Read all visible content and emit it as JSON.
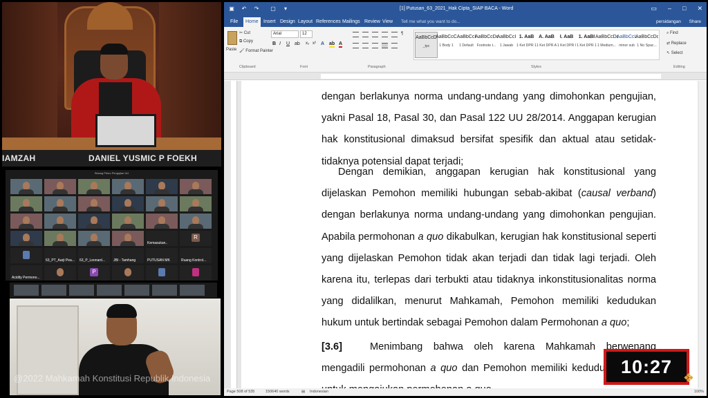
{
  "judge_panel": {
    "nameplate_left": "IAMZAH",
    "nameplate_main": "DANIEL YUSMIC P FOEKH"
  },
  "gallery": {
    "title": "Sidang Pleno Pengujian UU",
    "named_tiles": [
      {
        "label": "Kemasukan..",
        "initial": ""
      },
      {
        "label": "",
        "initial": "R"
      },
      {
        "label": "",
        "initial": ""
      },
      {
        "label": "63_PT_Aarji Pea...",
        "initial": ""
      },
      {
        "label": "63_P_Leonard...",
        "initial": ""
      },
      {
        "label": "JBI - Tamhang",
        "initial": ""
      },
      {
        "label": "PUTUSAN MK",
        "initial": ""
      },
      {
        "label": "Ruang Kontrol...",
        "initial": ""
      },
      {
        "label": "Acidity Permono...",
        "initial": ""
      },
      {
        "label": "",
        "initial": "P"
      }
    ]
  },
  "watermark": "@2022 Mahkamah Konstitusi Republik Indonesia",
  "word": {
    "title": "[1] Putusan_63_2021_Hak Cipta_SIAP BACA - Word",
    "tabs": [
      "File",
      "Home",
      "Insert",
      "Design",
      "Layout",
      "References",
      "Mailings",
      "Review",
      "View"
    ],
    "active_tab": "Home",
    "tell_me": "Tell me what you want to do...",
    "user": "persidangan",
    "share": "Share",
    "clipboard": {
      "paste": "Paste",
      "cut": "Cut",
      "copy": "Copy",
      "format_painter": "Format Painter",
      "label": "Clipboard"
    },
    "font": {
      "name": "Arial",
      "size": "12",
      "label": "Font"
    },
    "paragraph_label": "Paragraph",
    "styles_label": "Styles",
    "styles": [
      {
        "preview": "AaBbCcD",
        "name": "_tpc"
      },
      {
        "preview": "AaBbCcC",
        "name": "1 Body 1"
      },
      {
        "preview": "AaBbCcI",
        "name": "1 Default"
      },
      {
        "preview": "AaBbCcDd",
        "name": "Footnote t..."
      },
      {
        "preview": "AaBbCcI",
        "name": "1 Jawab"
      },
      {
        "preview": "1. AaB",
        "name": "1 Ket DPR 1"
      },
      {
        "preview": "A. AaB",
        "name": "1 Ket DPR A"
      },
      {
        "preview": "I. AaB",
        "name": "1 Ket DPR I"
      },
      {
        "preview": "1. AaBI",
        "name": "1 Ket DPR 1"
      },
      {
        "preview": "AaBbCcDd",
        "name": "1 Medium..."
      },
      {
        "preview": "AaBbCcL",
        "name": "minor sub"
      },
      {
        "preview": "AaBbCcDd",
        "name": "1 No Spac..."
      }
    ],
    "editing": {
      "find": "Find",
      "replace": "Replace",
      "select": "Select",
      "label": "Editing"
    },
    "status": {
      "page": "Page 508 of 535",
      "words": "150640 words",
      "language": "Indonesian",
      "zoom": "100%"
    }
  },
  "document": {
    "p1": "dengan berlakunya norma undang-undang yang dimohonkan pengujian, yakni Pasal 18, Pasal 30, dan Pasal 122 UU 28/2014. Anggapan kerugian hak konstitusional dimaksud bersifat spesifik dan aktual atau setidak-tidaknya potensial dapat terjadi;",
    "p2a": "Dengan demikian, anggapan kerugian hak konstitusional yang dijelaskan Pemohon memiliki hubungan sebab-akibat (",
    "p2_italic1": "causal verband",
    "p2b": ") dengan berlakunya norma undang-undang yang dimohonkan pengujian. Apabila permohonan ",
    "p2_italic2": "a quo",
    "p2c": " dikabulkan, kerugian hak konstitusional seperti yang dijelaskan Pemohon tidak akan terjadi dan tidak lagi terjadi. Oleh karena itu, terlepas dari terbukti atau tidaknya inkonstitusionalitas norma yang didalilkan, menurut Mahkamah, Pemohon memiliki kedudukan hukum untuk bertindak sebagai Pemohon dalam Permohonan ",
    "p2_italic3": "a quo",
    "p2d": ";",
    "p3_num": "[3.6]",
    "p3a": "Menimbang bahwa oleh karena Mahkamah berwenang mengadili permohonan ",
    "p3_italic": "a quo",
    "p3b": " dan Pemohon memiliki kedudukan hukum untuk mengajukan permohonan a quo"
  },
  "timer": "10:27",
  "colors": {
    "word_blue": "#2b579a",
    "timer_border": "#d01818",
    "robe_red": "#b01818"
  }
}
